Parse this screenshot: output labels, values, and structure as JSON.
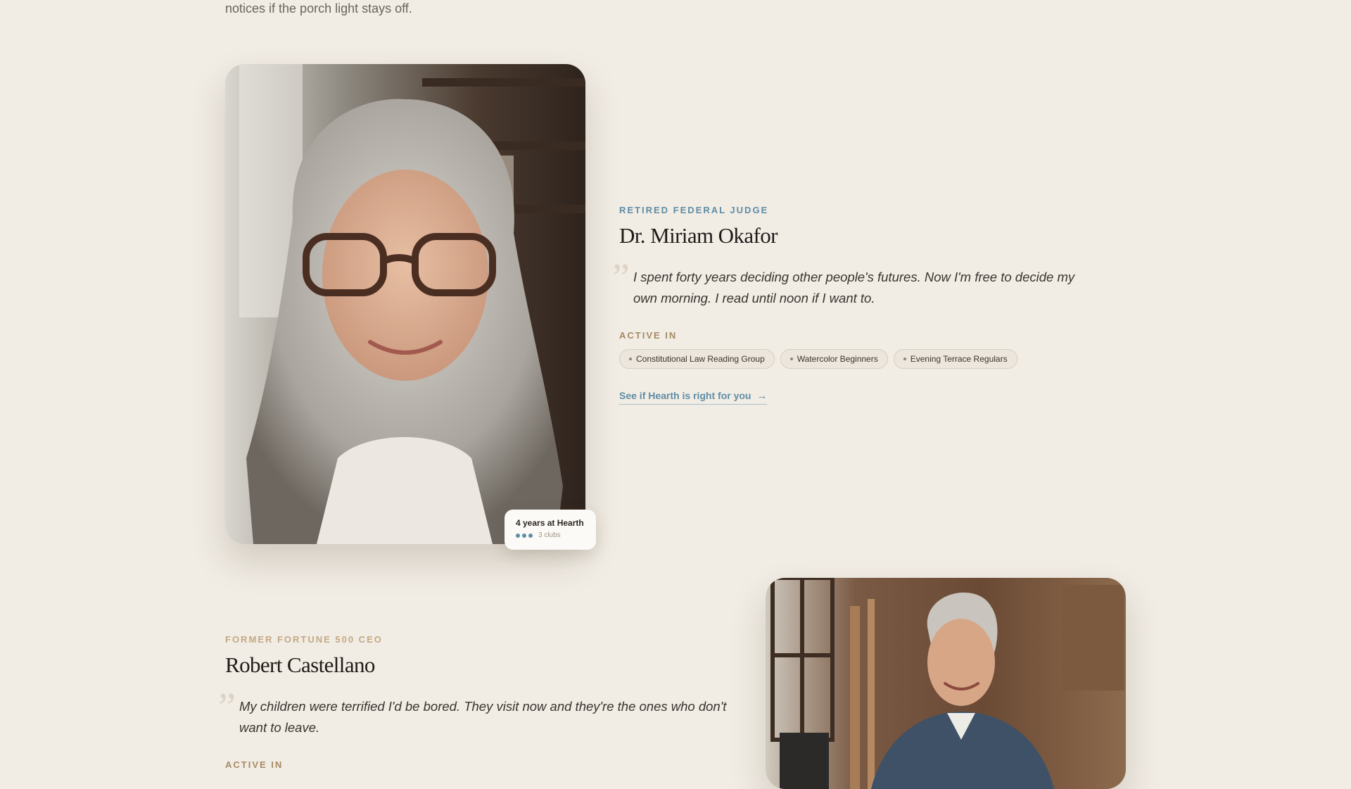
{
  "intro": {
    "text": "notices if the porch light stays off."
  },
  "profiles": [
    {
      "role": "RETIRED FEDERAL JUDGE",
      "name": "Dr. Miriam Okafor",
      "quote_mark": "”",
      "quote": "I spent forty years deciding other people's futures. Now I'm free to decide my own morning. I read until noon if I want to.",
      "active_label": "ACTIVE IN",
      "clubs": [
        "Constitutional Law Reading Group",
        "Watercolor Beginners",
        "Evening Terrace Regulars"
      ],
      "cta": "See if Hearth is right for you",
      "cta_arrow": "→",
      "badge": {
        "title": "4 years at Hearth",
        "clubs": "3 clubs",
        "dot_color": "#5f8da6"
      },
      "accent": "#5f8da6"
    },
    {
      "role": "FORMER FORTUNE 500 CEO",
      "name": "Robert Castellano",
      "quote_mark": "”",
      "quote": "My children were terrified I'd be bored. They visit now and they're the ones who don't want to leave.",
      "active_label": "ACTIVE IN",
      "accent": "#c4a983"
    }
  ],
  "colors": {
    "background": "#f1ece4",
    "blue_accent": "#5f8da6",
    "gold_accent": "#a68a64"
  }
}
